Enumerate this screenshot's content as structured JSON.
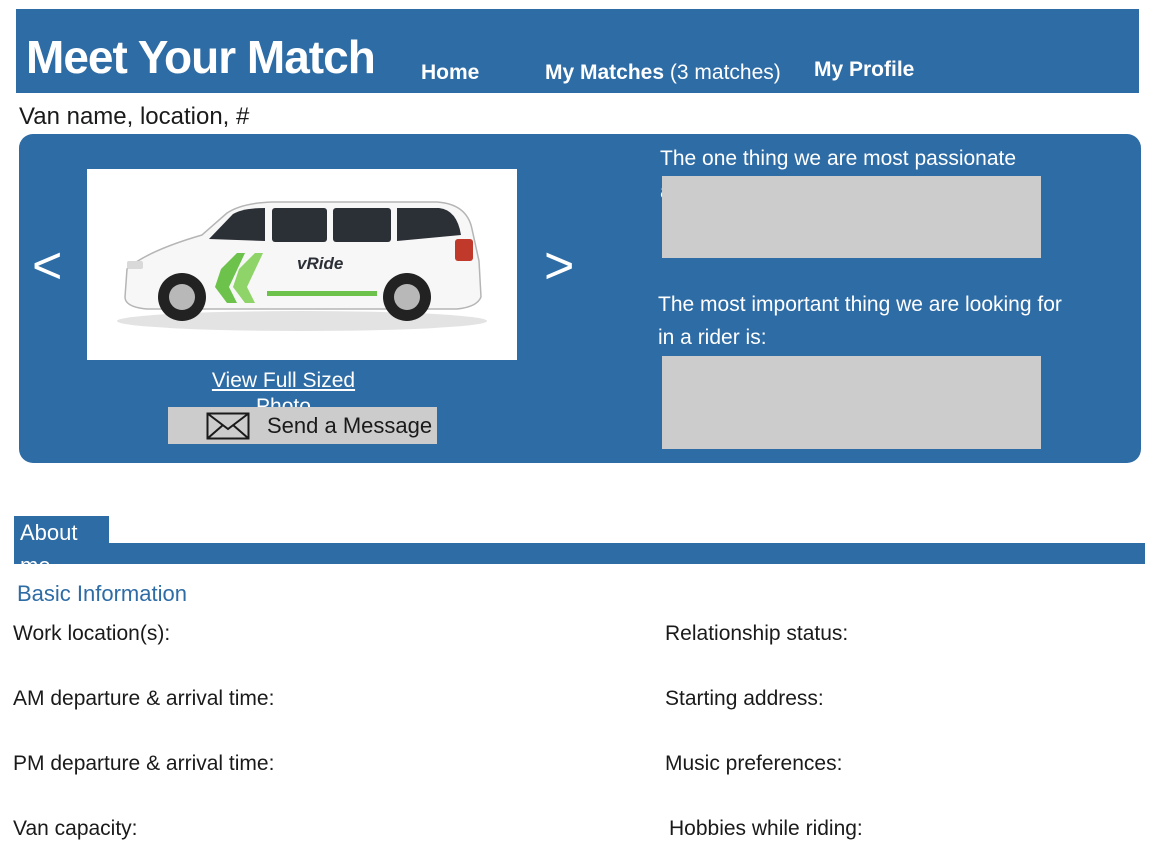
{
  "header": {
    "brand": "Meet Your Match",
    "nav": {
      "home": "Home",
      "matches": "My Matches",
      "matches_count": "(3 matches)",
      "profile": "My Profile"
    }
  },
  "subtitle": "Van name, location, #",
  "profile_panel": {
    "prev_arrow": "<",
    "next_arrow": ">",
    "photo_icon": "van-photo",
    "view_photo_link": "View Full Sized Photo",
    "send_message_label": "Send a Message",
    "send_message_icon": "envelope-icon",
    "question_passionate": "The one thing we are most passionate about:",
    "question_looking_for": "The most important thing we are looking for in a rider is:",
    "answer_passionate": "",
    "answer_looking_for": ""
  },
  "about": {
    "tab_label": "About me",
    "basic_heading": "Basic Information",
    "left_fields": [
      "Work location(s):",
      "AM departure & arrival time:",
      "PM departure & arrival time:",
      "Van capacity:"
    ],
    "right_fields": [
      "Relationship status:",
      "Starting address:",
      "Music preferences:",
      "Hobbies while riding:"
    ]
  },
  "colors": {
    "brand_blue": "#2e6ca6",
    "box_gray": "#cccccc",
    "van_green": "#6cc24a"
  }
}
